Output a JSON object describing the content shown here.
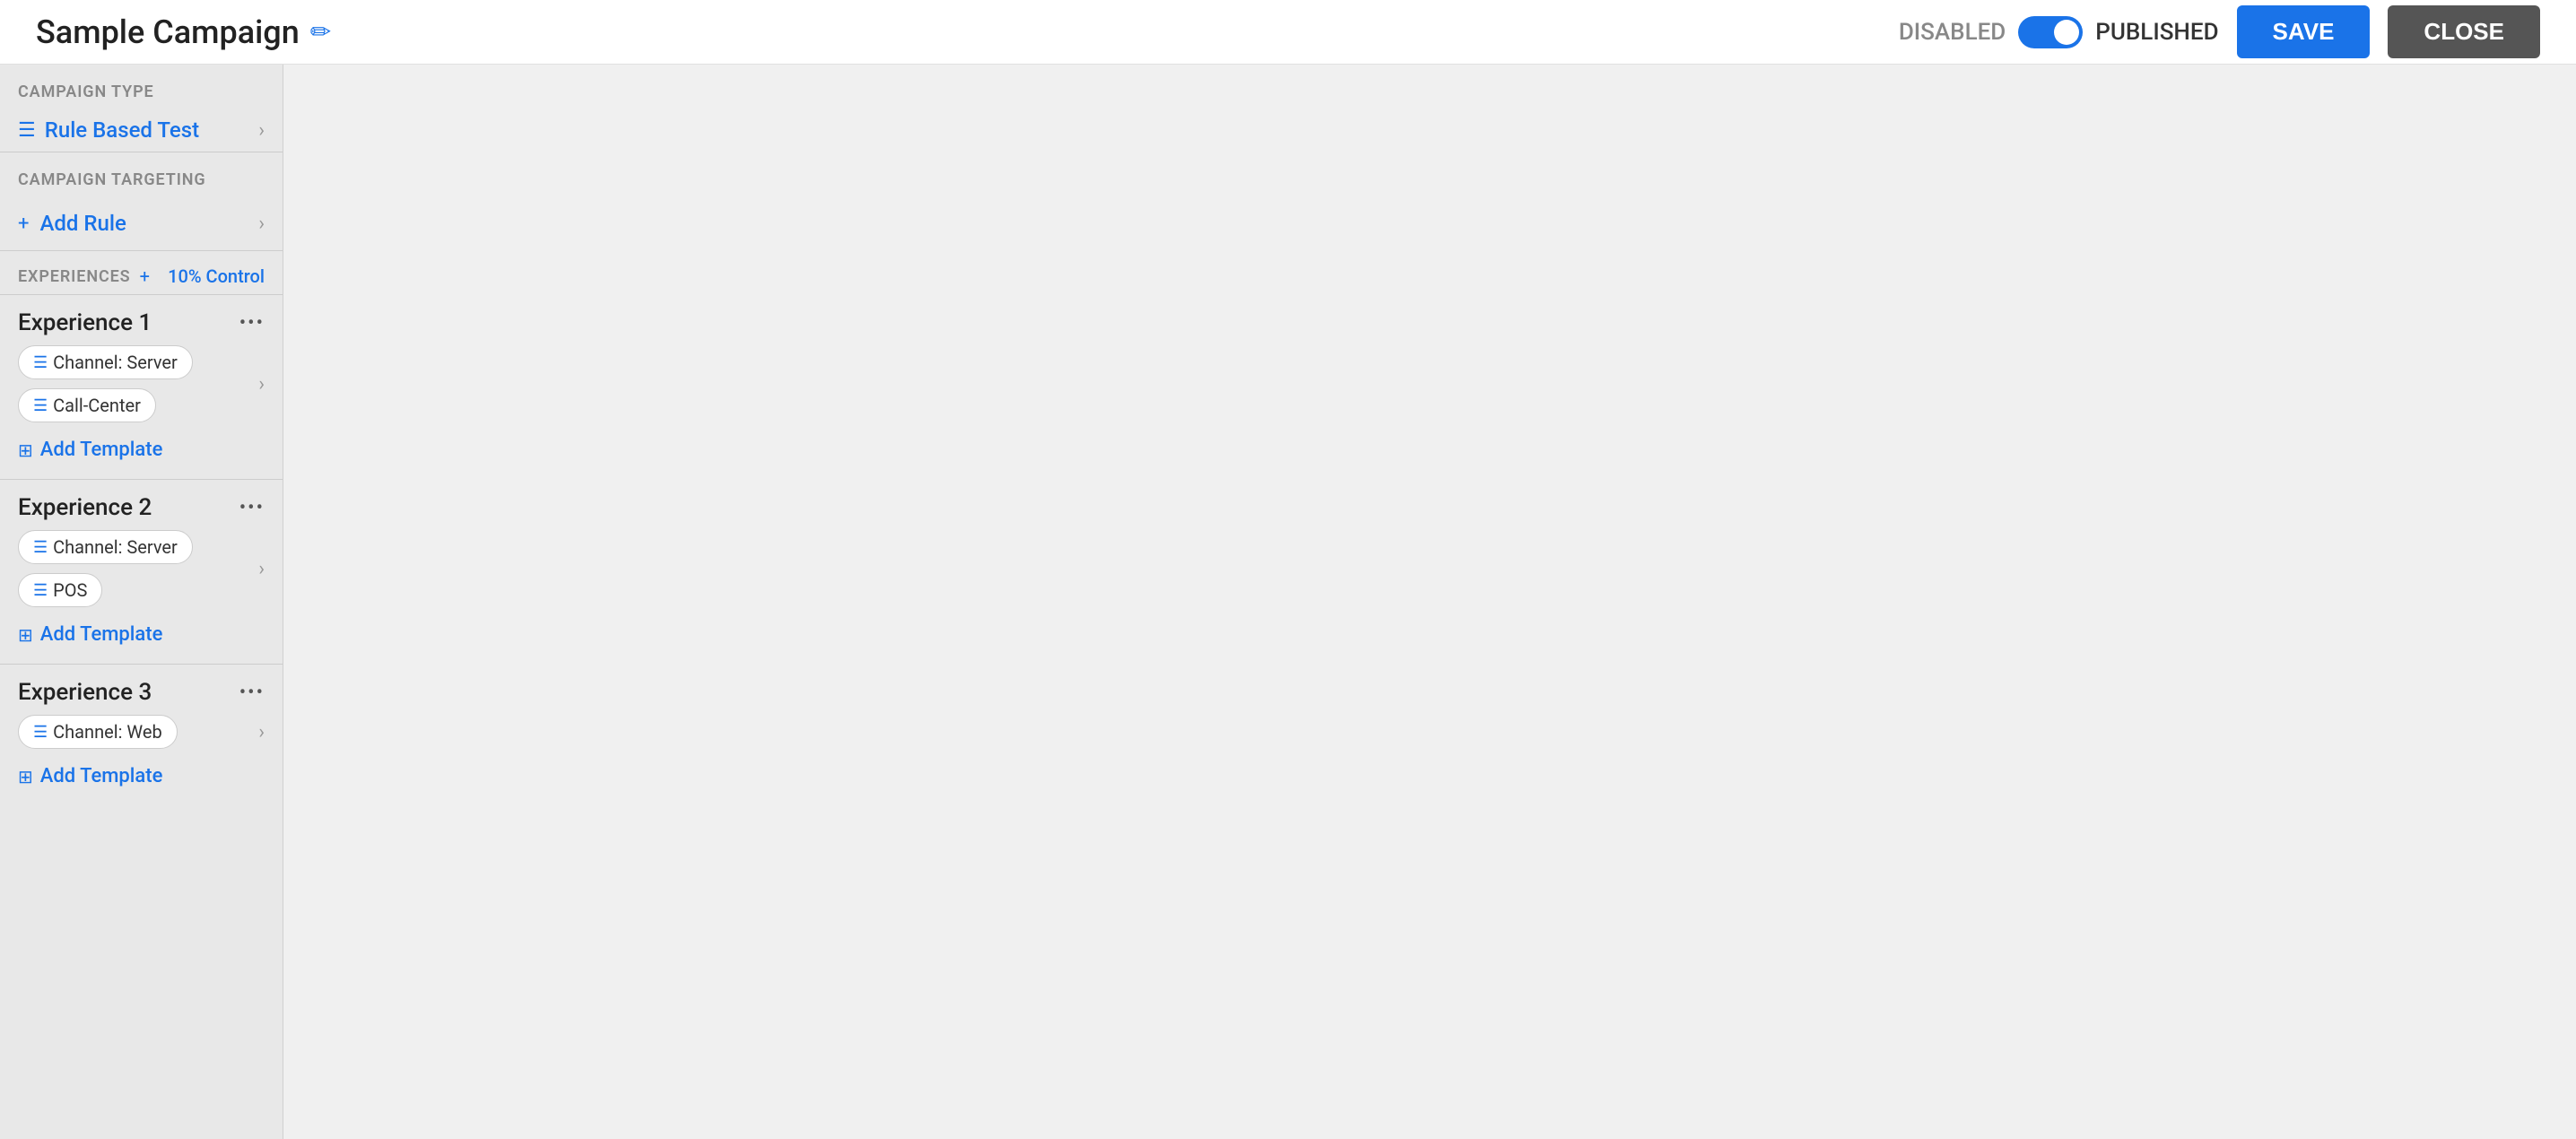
{
  "header": {
    "title": "Sample Campaign",
    "edit_icon": "✏",
    "toggle_disabled_label": "DISABLED",
    "toggle_published_label": "PUBLISHED",
    "save_label": "SAVE",
    "close_label": "CLOSE"
  },
  "sidebar": {
    "campaign_type_section_label": "CAMPAIGN TYPE",
    "campaign_type": {
      "icon": "☰",
      "label": "Rule Based Test"
    },
    "campaign_targeting_section_label": "CAMPAIGN TARGETING",
    "add_rule": {
      "prefix": "+",
      "label": "Add Rule"
    },
    "experiences_label": "EXPERIENCES",
    "experiences_control": "10% Control",
    "experiences": [
      {
        "name": "Experience 1",
        "channels": [
          {
            "icon": "☰",
            "label": "Channel: Server"
          },
          {
            "icon": "☰",
            "label": "Call-Center"
          }
        ],
        "add_template_label": "Add Template"
      },
      {
        "name": "Experience 2",
        "channels": [
          {
            "icon": "☰",
            "label": "Channel: Server"
          },
          {
            "icon": "☰",
            "label": "POS"
          }
        ],
        "add_template_label": "Add Template"
      },
      {
        "name": "Experience 3",
        "channels": [
          {
            "icon": "☰",
            "label": "Channel: Web"
          }
        ],
        "add_template_label": "Add Template"
      }
    ]
  }
}
